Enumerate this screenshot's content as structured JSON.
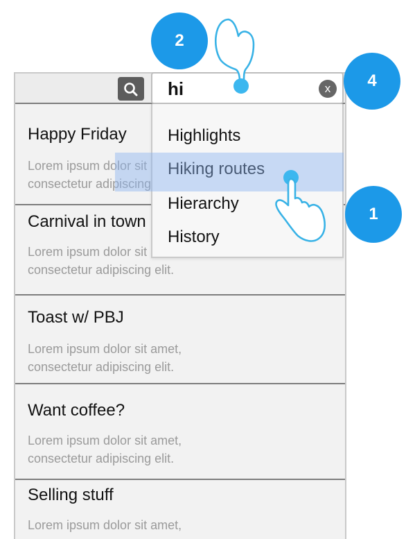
{
  "search": {
    "value": "hi",
    "clear_label": "x",
    "suggestions": [
      "Highlights",
      "Hiking routes",
      "Hierarchy",
      "History"
    ],
    "selected_index": 1
  },
  "list": [
    {
      "title": "Happy Friday",
      "desc1": "Lorem ipsum dolor sit amet,",
      "desc2": "consectetur adipiscing elit."
    },
    {
      "title": "Carnival in town",
      "desc1": "Lorem ipsum dolor sit amet,",
      "desc2": "consectetur adipiscing elit."
    },
    {
      "title": "Toast w/ PBJ",
      "desc1": "Lorem ipsum dolor sit amet,",
      "desc2": "consectetur adipiscing elit."
    },
    {
      "title": "Want coffee?",
      "desc1": "Lorem ipsum dolor sit amet,",
      "desc2": "consectetur adipiscing elit."
    },
    {
      "title": "Selling stuff",
      "desc1": "Lorem ipsum dolor sit amet,",
      "desc2": ""
    }
  ],
  "annotations": {
    "step1": "1",
    "step2": "2",
    "step4": "4"
  },
  "colors": {
    "accent": "#1c99e8",
    "selection": "#a9c8f3",
    "toolbar_button": "#5c5c5c"
  },
  "icons": {
    "search": "search-icon",
    "clear": "close-icon",
    "gesture": "hand-pointer-icon"
  }
}
